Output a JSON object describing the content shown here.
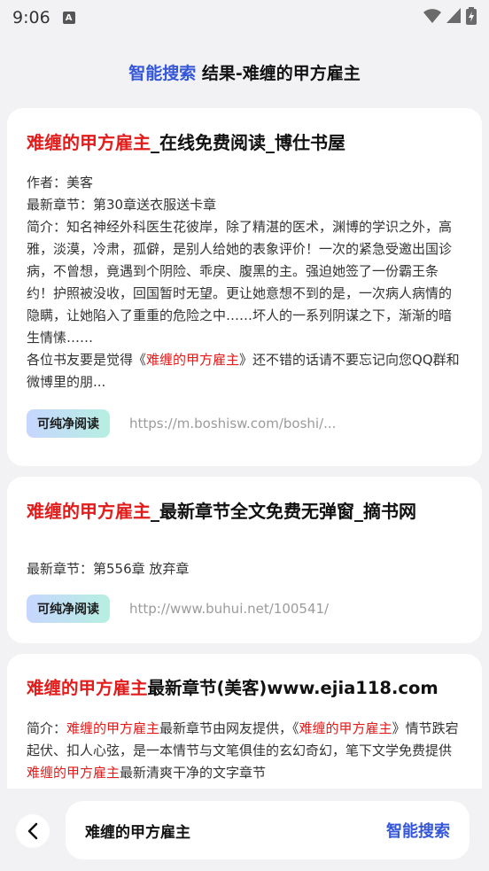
{
  "status": {
    "time": "9:06",
    "notif": "A"
  },
  "header": {
    "accent": "智能搜索",
    "rest": " 结果-难缠的甲方雇主"
  },
  "results": [
    {
      "title_hl": "难缠的甲方雇主",
      "title_rest": "_在线免费阅读_博仕书屋",
      "author": "作者：美客",
      "latest": "最新章节：第30章送衣服送卡章",
      "summary": "简介：知名神经外科医生花彼岸，除了精湛的医术，渊博的学识之外，高雅，淡漠，冷肃，孤僻，是别人给她的表象评价！一次的紧急受邀出国诊病，不曾想，竟遇到个阴险、乖戾、腹黑的主。强迫她签了一份霸王条约！护照被没收，回国暂时无望。更让她意想不到的是，一次病人病情的隐瞒，让她陷入了重重的危险之中……坏人的一系列阴谋之下，渐渐的暗生情愫……",
      "note_pre": "各位书友要是觉得《",
      "note_hl": "难缠的甲方雇主",
      "note_post": "》还不错的话请不要忘记向您QQ群和微博里的朋...",
      "button": "可纯净阅读",
      "url": "https://m.boshisw.com/boshi/..."
    },
    {
      "title_hl": "难缠的甲方雇主",
      "title_rest": "_最新章节全文免费无弹窗_摘书网",
      "latest": "最新章节：第556章 放弃章",
      "button": "可纯净阅读",
      "url": "http://www.buhui.net/100541/"
    },
    {
      "title_hl": "难缠的甲方雇主",
      "title_rest": "最新章节(美客)www.ejia118.com",
      "s1": "简介：",
      "s2": "难缠的甲方雇主",
      "s3": "最新章节由网友提供，《",
      "s4": "难缠的甲方雇主",
      "s5": "》情节跌宕起伏、扣人心弦，是一本情节与文笔俱佳的玄幻奇幻，笔下文学免费提供",
      "s6": "难缠的甲方雇主",
      "s7": "最新清爽干净的文字章节"
    }
  ],
  "bottom": {
    "query": "难缠的甲方雇主",
    "search_label": "智能搜索"
  },
  "colors": {
    "accent": "#3456d8",
    "highlight": "#e21b1b"
  }
}
